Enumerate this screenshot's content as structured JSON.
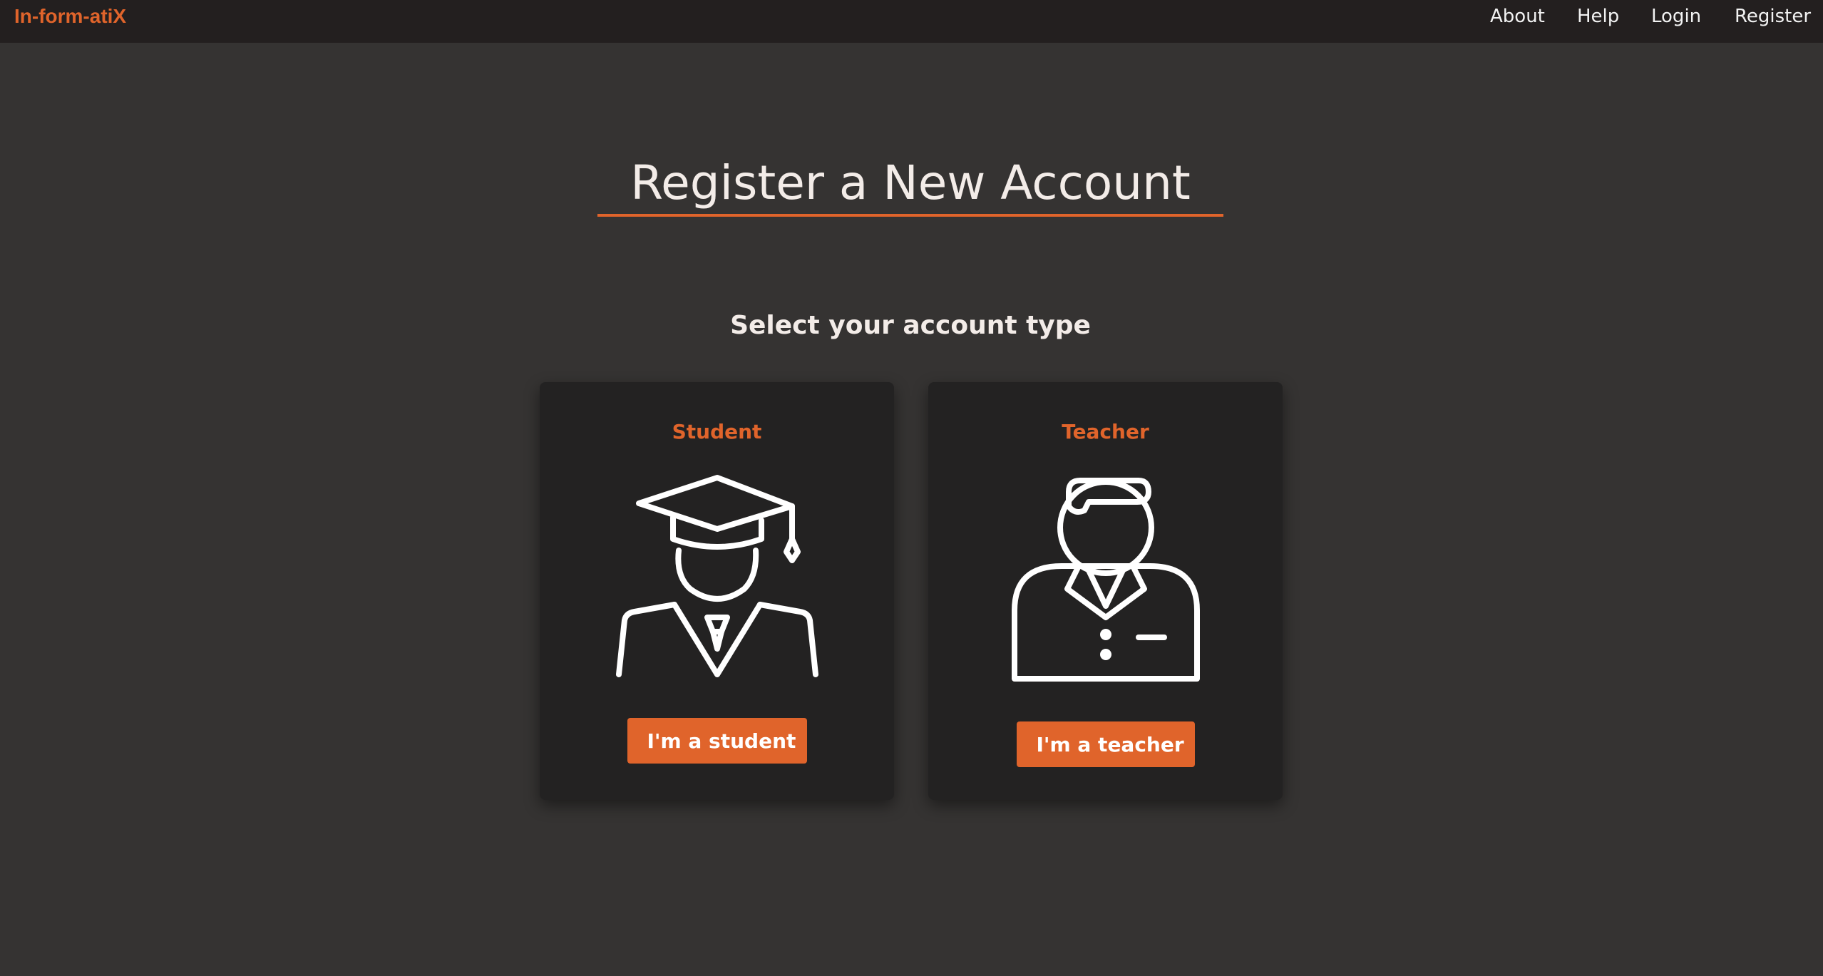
{
  "brand": "In-form-atiX",
  "nav": {
    "about": "About",
    "help": "Help",
    "login": "Login",
    "register": "Register"
  },
  "page": {
    "title": "Register a New Account",
    "subtitle": "Select your account type"
  },
  "cards": {
    "student": {
      "label": "Student",
      "icon": "graduate-icon",
      "button": "I'm a student"
    },
    "teacher": {
      "label": "Teacher",
      "icon": "teacher-icon",
      "button": "I'm a teacher"
    }
  },
  "colors": {
    "accent": "#e0642b",
    "background": "#353332",
    "navbar": "#231f1f",
    "card": "#232222"
  }
}
